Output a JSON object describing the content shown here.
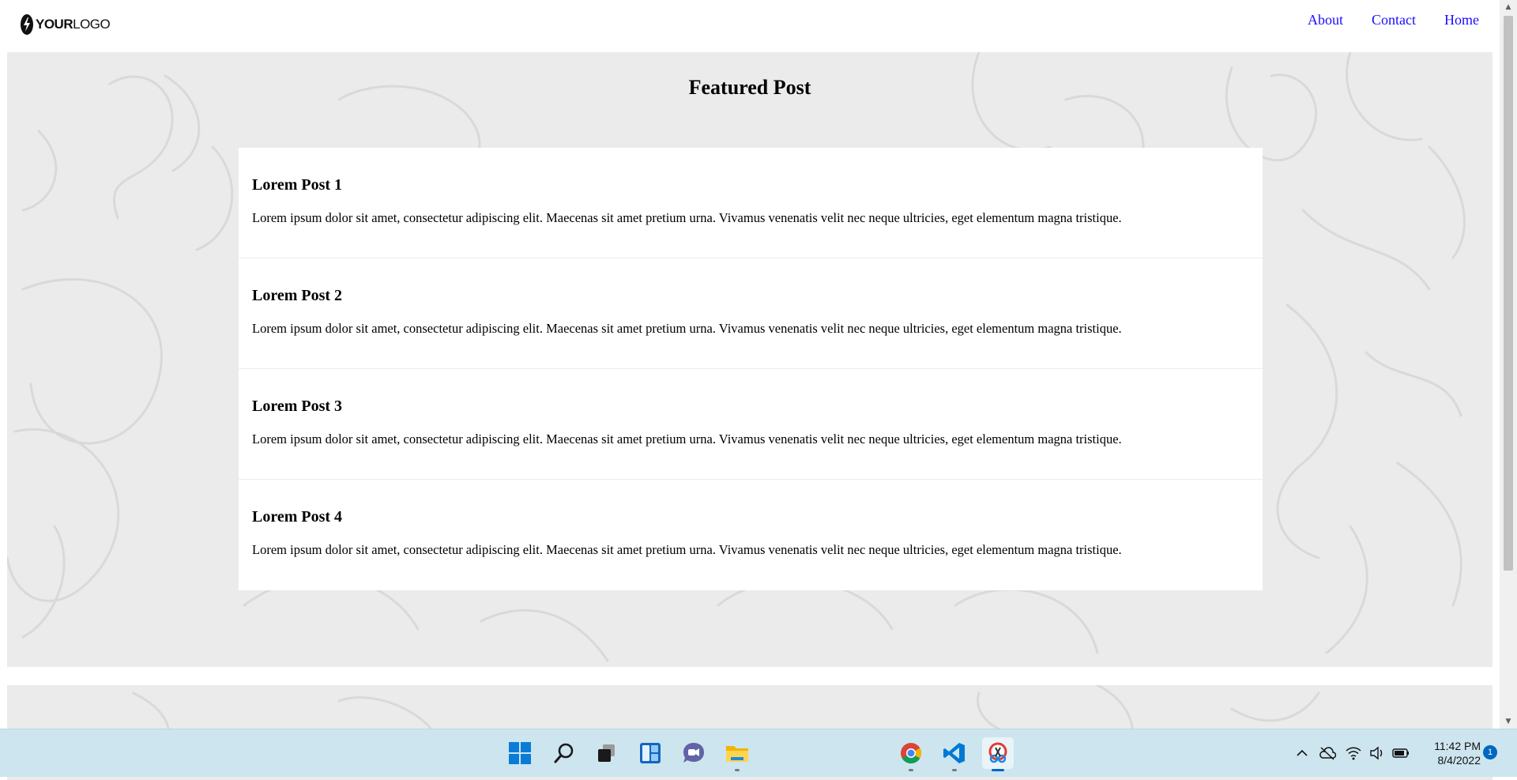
{
  "header": {
    "logo_bold": "YOUR",
    "logo_light": "LOGO",
    "nav": [
      {
        "label": "About"
      },
      {
        "label": "Contact"
      },
      {
        "label": "Home"
      }
    ]
  },
  "featured": {
    "title": "Featured Post",
    "posts": [
      {
        "title": "Lorem Post 1",
        "body": "Lorem ipsum dolor sit amet, consectetur adipiscing elit. Maecenas sit amet pretium urna. Vivamus venenatis velit nec neque ultricies, eget elementum magna tristique."
      },
      {
        "title": "Lorem Post 2",
        "body": "Lorem ipsum dolor sit amet, consectetur adipiscing elit. Maecenas sit amet pretium urna. Vivamus venenatis velit nec neque ultricies, eget elementum magna tristique."
      },
      {
        "title": "Lorem Post 3",
        "body": "Lorem ipsum dolor sit amet, consectetur adipiscing elit. Maecenas sit amet pretium urna. Vivamus venenatis velit nec neque ultricies, eget elementum magna tristique."
      },
      {
        "title": "Lorem Post 4",
        "body": "Lorem ipsum dolor sit amet, consectetur adipiscing elit. Maecenas sit amet pretium urna. Vivamus venenatis velit nec neque ultricies, eget elementum magna tristique."
      }
    ]
  },
  "colors": {
    "link": "#1a0dff",
    "section_bg": "#ebebeb",
    "taskbar_bg": "#cde5ee",
    "accent": "#0067c0"
  },
  "taskbar": {
    "apps": [
      {
        "icon": "windows-start-icon"
      },
      {
        "icon": "search-icon"
      },
      {
        "icon": "task-view-icon"
      },
      {
        "icon": "widgets-icon"
      },
      {
        "icon": "teams-chat-icon"
      },
      {
        "icon": "file-explorer-icon"
      },
      {
        "icon": "chrome-icon"
      },
      {
        "icon": "vscode-icon"
      },
      {
        "icon": "snipping-tool-icon"
      }
    ],
    "tray_icons": [
      "chevron-up-icon",
      "onedrive-icon",
      "wifi-icon",
      "volume-icon",
      "battery-icon"
    ],
    "time": "11:42 PM",
    "date": "8/4/2022",
    "notification_count": "1"
  }
}
